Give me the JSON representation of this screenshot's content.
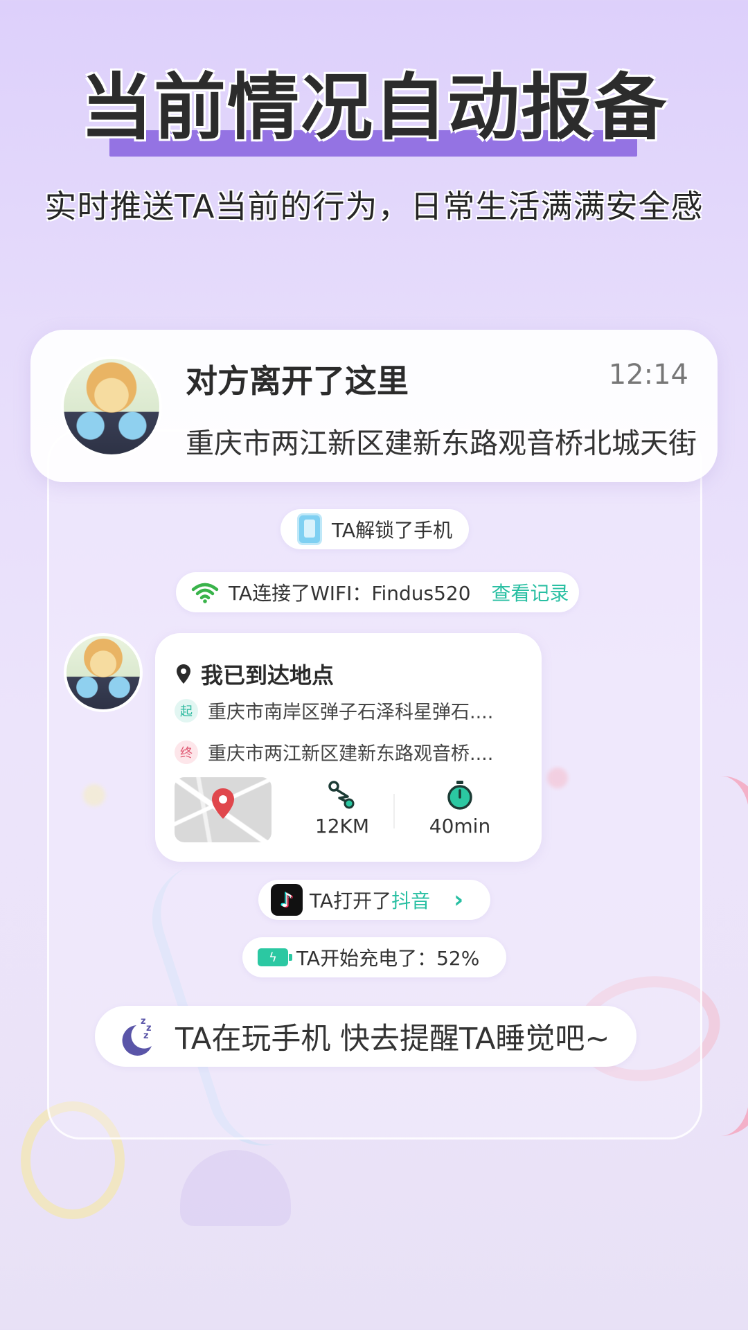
{
  "header": {
    "headline": "当前情况自动报备",
    "subheadline": "实时推送TA当前的行为，日常生活满满安全感"
  },
  "notification": {
    "title": "对方离开了这里",
    "time": "12:14",
    "address": "重庆市两江新区建新东路观音桥北城天街"
  },
  "events": {
    "unlock": "TA解锁了手机",
    "wifi": {
      "text": "TA连接了WIFI：Findus520",
      "link": "查看记录"
    },
    "arrival": {
      "title": "我已到达地点",
      "start_tag": "起",
      "start_address": "重庆市南岸区弹子石泽科星弹石....",
      "end_tag": "终",
      "end_address": "重庆市两江新区建新东路观音桥....",
      "distance": "12KM",
      "duration": "40min"
    },
    "app_open": {
      "prefix": "TA打开了",
      "app": "抖音"
    },
    "charging": "TA开始充电了：52%",
    "sleep_reminder": "TA在玩手机 快去提醒TA睡觉吧~"
  },
  "colors": {
    "accent_purple": "#8c68e0",
    "accent_green": "#28bfa2",
    "end_tag_red": "#e05a74"
  },
  "icons": [
    "phone-icon",
    "wifi-icon",
    "location-pin-icon",
    "route-icon",
    "stopwatch-icon",
    "map-pin-icon",
    "douyin-icon",
    "chevron-right-icon",
    "battery-charging-icon",
    "moon-sleep-icon"
  ]
}
